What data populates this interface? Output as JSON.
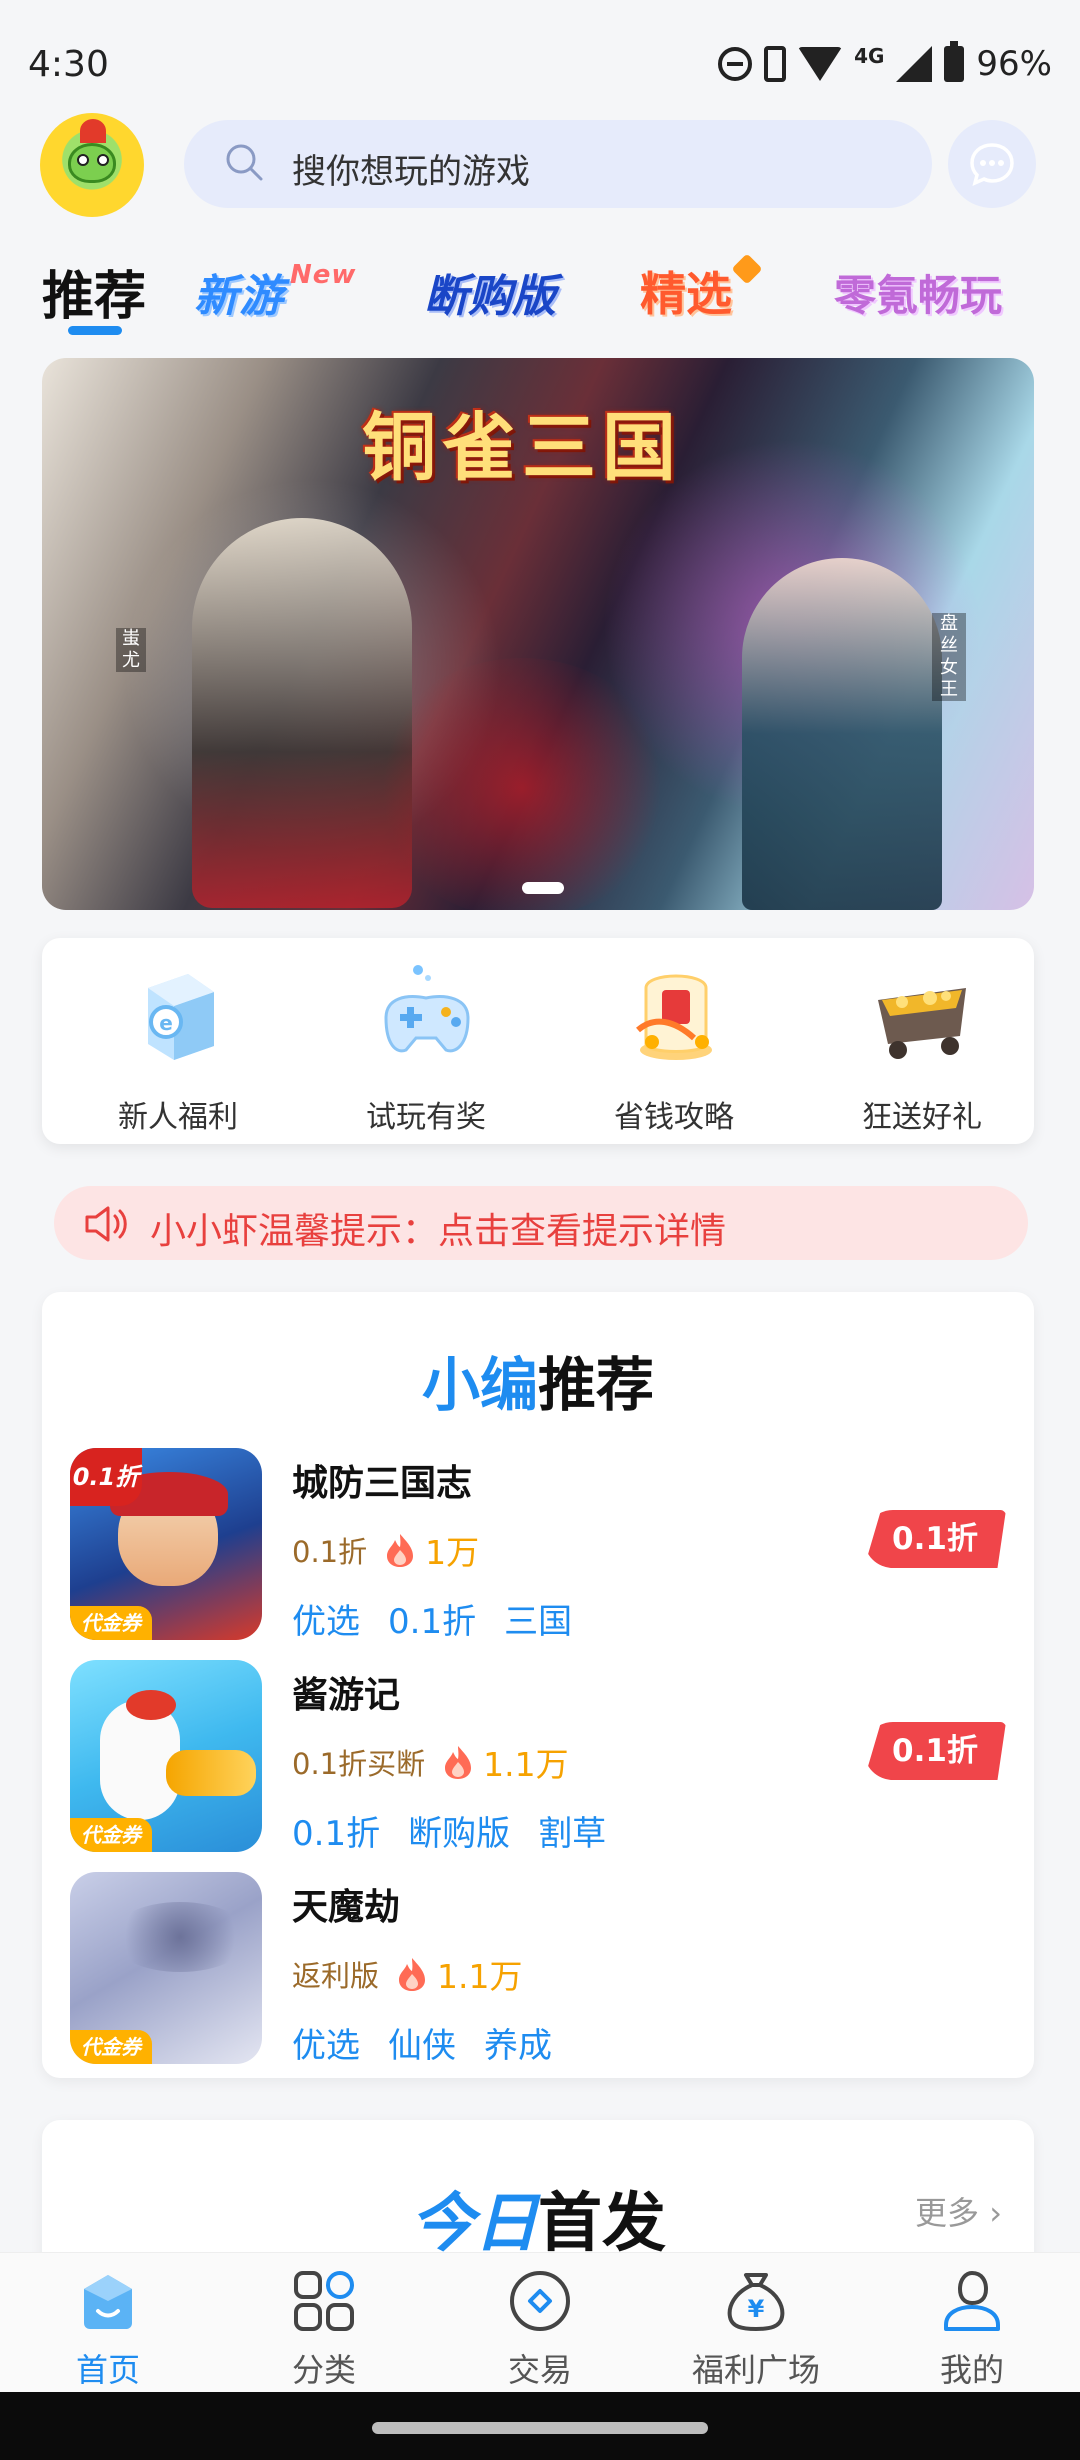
{
  "status_bar": {
    "time": "4:30",
    "network": "4G",
    "battery": "96%"
  },
  "header": {
    "search_placeholder": "搜你想玩的游戏",
    "icons": [
      "avatar",
      "search-icon",
      "message-icon"
    ]
  },
  "tabs": {
    "recommend": "推荐",
    "new_games": "新游",
    "new_badge": "New",
    "buyout": "断购版",
    "selected": "精选",
    "zero_kr": "零氪畅玩"
  },
  "banner": {
    "title": "铜雀三国",
    "left_caption": "蚩尤",
    "right_caption": "盘丝女王"
  },
  "features": [
    {
      "label": "新人福利",
      "icon": "gift-box-icon"
    },
    {
      "label": "试玩有奖",
      "icon": "gamepad-icon"
    },
    {
      "label": "省钱攻略",
      "icon": "coupon-icon"
    },
    {
      "label": "狂送好礼",
      "icon": "treasure-cart-icon"
    }
  ],
  "notice": {
    "text": "小小虾温馨提示：点击查看提示详情"
  },
  "recommend_section": {
    "title_blue": "小编",
    "title_black": "推荐",
    "games": [
      {
        "name": "城防三国志",
        "subtitle": "0.1折",
        "heat": "1万",
        "tags": [
          "优选",
          "0.1折",
          "三国"
        ],
        "badge": "0.1折",
        "icon_discount_tag": "0.1折",
        "voucher_tag": "代金券"
      },
      {
        "name": "酱游记",
        "subtitle": "0.1折买断",
        "heat": "1.1万",
        "tags": [
          "0.1折",
          "断购版",
          "割草"
        ],
        "badge": "0.1折",
        "voucher_tag": "代金券"
      },
      {
        "name": "天魔劫",
        "subtitle": "返利版",
        "heat": "1.1万",
        "tags": [
          "优选",
          "仙侠",
          "养成"
        ],
        "voucher_tag": "代金券"
      }
    ]
  },
  "today_section": {
    "title_blue": "今日",
    "title_black": "首发",
    "more": "更多"
  },
  "bottom_nav": [
    {
      "label": "首页",
      "icon": "home-icon",
      "active": true
    },
    {
      "label": "分类",
      "icon": "category-icon",
      "active": false
    },
    {
      "label": "交易",
      "icon": "trade-icon",
      "active": false
    },
    {
      "label": "福利广场",
      "icon": "money-bag-icon",
      "active": false
    },
    {
      "label": "我的",
      "icon": "profile-icon",
      "active": false
    }
  ],
  "colors": {
    "accent_blue": "#1e8cf0",
    "discount_red": "#f0454a",
    "heat_orange": "#f6a200",
    "notice_red": "#e8403e",
    "search_bg": "#e6ebfb"
  }
}
